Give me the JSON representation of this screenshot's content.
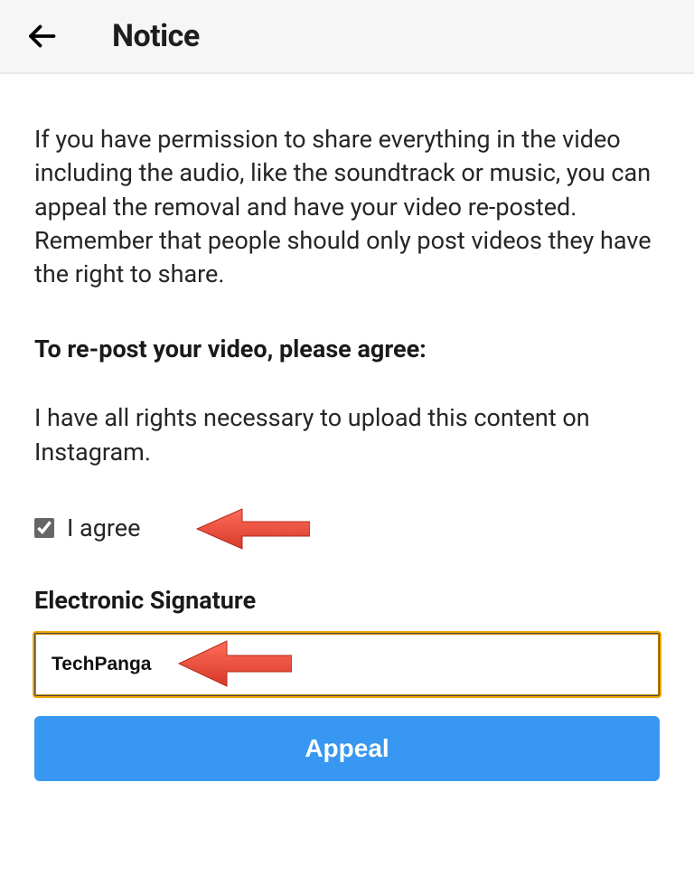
{
  "header": {
    "title": "Notice"
  },
  "body": {
    "main_text": "If you have permission to share everything in the video including the audio, like the soundtrack or music, you can appeal the removal and have your video re-posted. Remember that people should only post videos they have the right to share.",
    "agree_heading": "To re-post your video, please agree:",
    "rights_statement": "I have all rights necessary to upload this content on Instagram."
  },
  "checkbox": {
    "label": "I agree",
    "checked": true
  },
  "signature": {
    "heading": "Electronic Signature",
    "value": "TechPanga"
  },
  "button": {
    "appeal_label": "Appeal"
  },
  "colors": {
    "primary_blue": "#3897f0",
    "arrow_red": "#f44336"
  }
}
